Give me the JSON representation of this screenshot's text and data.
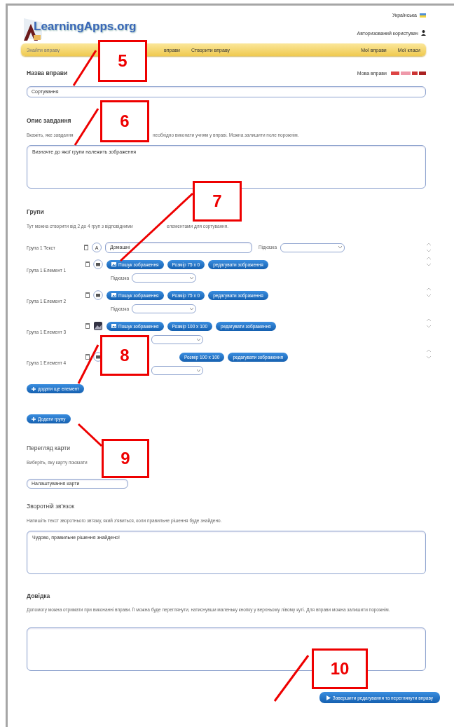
{
  "header": {
    "logo": "LearningApps.org",
    "language": "Українська",
    "user": "Авторизований користувач"
  },
  "nav": {
    "search_placeholder": "Знайти вправу",
    "left_items": [
      {
        "label": "вправи"
      },
      {
        "label": "Створити вправу"
      }
    ],
    "right_items": [
      {
        "label": "Мої вправи"
      },
      {
        "label": "Мої класи"
      }
    ]
  },
  "title_section": {
    "label": "Назва вправи",
    "language_label": "Мова вправи",
    "value": "Сортування"
  },
  "description": {
    "label": "Опис завдання",
    "hint_start": "Вкажіть, яке завдання",
    "hint_end": "необхідно виконати учням у вправі. Можна залишити поле порожнім.",
    "value": "Визначте до якої групи належить зображення"
  },
  "groups": {
    "label": "Групи",
    "hint_start": "Тут можна створити від 2 до 4 груп з відповідними",
    "hint_end": "елементами для сортування.",
    "rows": [
      {
        "kind": "text",
        "label": "Група 1 Текст",
        "mode_label": "A",
        "value": "Домашні",
        "hint_label": "Підказка"
      },
      {
        "kind": "image",
        "label": "Група 1 Елемент 1",
        "buttons": [
          "Пошук зображення",
          "Розмір 75 x 0",
          "редагувати зображення"
        ],
        "hint_label": "Підказка",
        "has_image": false
      },
      {
        "kind": "image",
        "label": "Група 1 Елемент 2",
        "buttons": [
          "Пошук зображення",
          "Розмір 75 x 0",
          "редагувати зображення"
        ],
        "hint_label": "Підказка",
        "has_image": false
      },
      {
        "kind": "image",
        "label": "Група 1 Елемент 3",
        "buttons": [
          "Пошук зображення",
          "Розмір 100 x 100",
          "редагувати зображення"
        ],
        "has_image": true
      },
      {
        "kind": "image",
        "label": "Група 1 Елемент 4",
        "buttons": [
          "Розмір 100 x 100",
          "редагувати зображення"
        ],
        "has_image": false
      }
    ],
    "add_element": "додати ще елемент",
    "add_group": "Додати групу"
  },
  "map_preview": {
    "label": "Перегляд карти",
    "hint": "Виберіть, яку карту показати",
    "select_value": "Налаштування карти"
  },
  "feedback": {
    "label": "Зворотній зв'язок",
    "hint": "Напишіть текст зворотнього зв'язку, який з'явиться, коли правильне рішення буде знайдено.",
    "value": "Чудово, правильне рішення знайдено!"
  },
  "help": {
    "label": "Довідка",
    "hint": "Допомогу можна отримати при виконанні вправи. Її можна буде переглянути, натиснувши маленьку кнопку у верхньому лівому куті. Для вправи можна залишити порожнім."
  },
  "finish_button": "Завершити редагування та переглянути вправу",
  "callouts": [
    {
      "number": "5"
    },
    {
      "number": "6"
    },
    {
      "number": "7"
    },
    {
      "number": "8"
    },
    {
      "number": "9"
    },
    {
      "number": "10"
    }
  ]
}
